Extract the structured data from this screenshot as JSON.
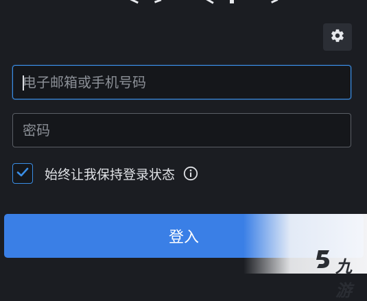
{
  "settings": {
    "icon": "gear-icon"
  },
  "login_form": {
    "email_placeholder": "电子邮箱或手机号码",
    "email_value": "",
    "password_placeholder": "密码",
    "password_value": "",
    "remember_label": "始终让我保持登录状态",
    "remember_checked": true,
    "info_icon": "info-icon",
    "submit_label": "登入"
  },
  "watermark": {
    "text": "九游"
  },
  "colors": {
    "accent": "#3a7fe6",
    "focus_border": "#3a8ee6",
    "background": "#1b1d22"
  }
}
